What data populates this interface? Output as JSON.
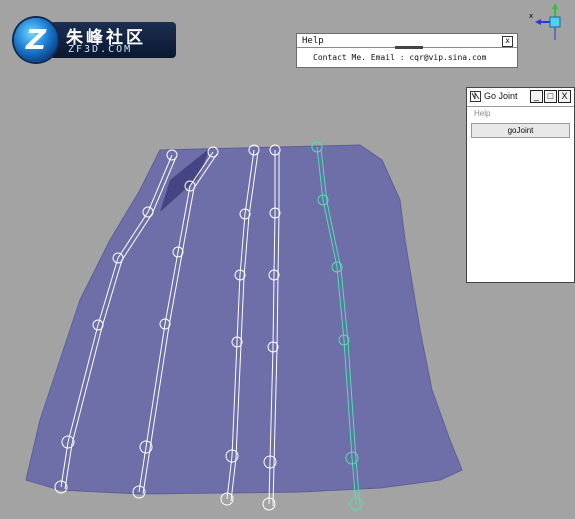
{
  "logo": {
    "badge_letter": "Z",
    "title_cn": "朱峰社区",
    "title_en": "ZF3D.COM"
  },
  "viewport": {
    "mesh_color": "#6e6ea8",
    "joint_color": "#ffffff",
    "selected_joint_color": "#4fe0b0",
    "background": "#a3a3a3"
  },
  "gizmo": {
    "x_label": "x"
  },
  "help_window": {
    "title": "Help",
    "close_label": "x",
    "contact_text": "Contact Me.  Email : cqr@vip.sina.com"
  },
  "gojoint_window": {
    "title": "Go Joint",
    "minimize_label": "_",
    "maximize_label": "□",
    "close_label": "X",
    "menu_help": "Help",
    "action_button": "goJoint"
  }
}
